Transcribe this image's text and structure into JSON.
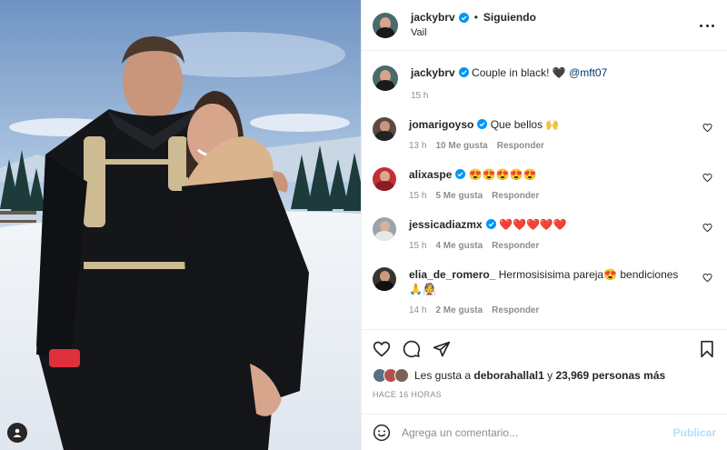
{
  "post": {
    "author": "jackybrv",
    "follow_state": "Siguiendo",
    "location": "Vail",
    "dot": "•"
  },
  "caption": {
    "username": "jackybrv",
    "text": "Couple in black! 🖤",
    "mention": "@mft07",
    "time": "15 h"
  },
  "comments": [
    {
      "username": "jomarigoyso",
      "verified": true,
      "text": "Que bellos 🙌",
      "time": "13 h",
      "likes": "10 Me gusta",
      "reply": "Responder"
    },
    {
      "username": "alixaspe",
      "verified": true,
      "text": "😍😍😍😍😍",
      "time": "15 h",
      "likes": "5 Me gusta",
      "reply": "Responder"
    },
    {
      "username": "jessicadiazmx",
      "verified": true,
      "text": "❤️❤️❤️❤️❤️",
      "time": "15 h",
      "likes": "4 Me gusta",
      "reply": "Responder"
    },
    {
      "username": "elia_de_romero_",
      "verified": false,
      "text": "Hermosisisima pareja😍 bendiciones 🙏👰",
      "time": "14 h",
      "likes": "2 Me gusta",
      "reply": "Responder"
    }
  ],
  "likes": {
    "prefix": "Les gusta a",
    "user": "deborahallal1",
    "middle": "y",
    "count": "23,969 personas más"
  },
  "time_ago": "HACE 16 HORAS",
  "add_comment": {
    "placeholder": "Agrega un comentario...",
    "publish": "Publicar"
  },
  "icons": {
    "more": "more-horizontal-icon",
    "like": "heart-icon",
    "comment": "comment-bubble-icon",
    "share": "paper-plane-icon",
    "save": "bookmark-icon",
    "emoji": "smiley-icon",
    "tag": "user-tag-icon",
    "verified": "verified-badge-icon"
  },
  "colors": {
    "verified": "#0095f6",
    "publish_disabled": "#b2dffc",
    "muted_text": "#8e8e8e",
    "mention": "#00376b"
  }
}
